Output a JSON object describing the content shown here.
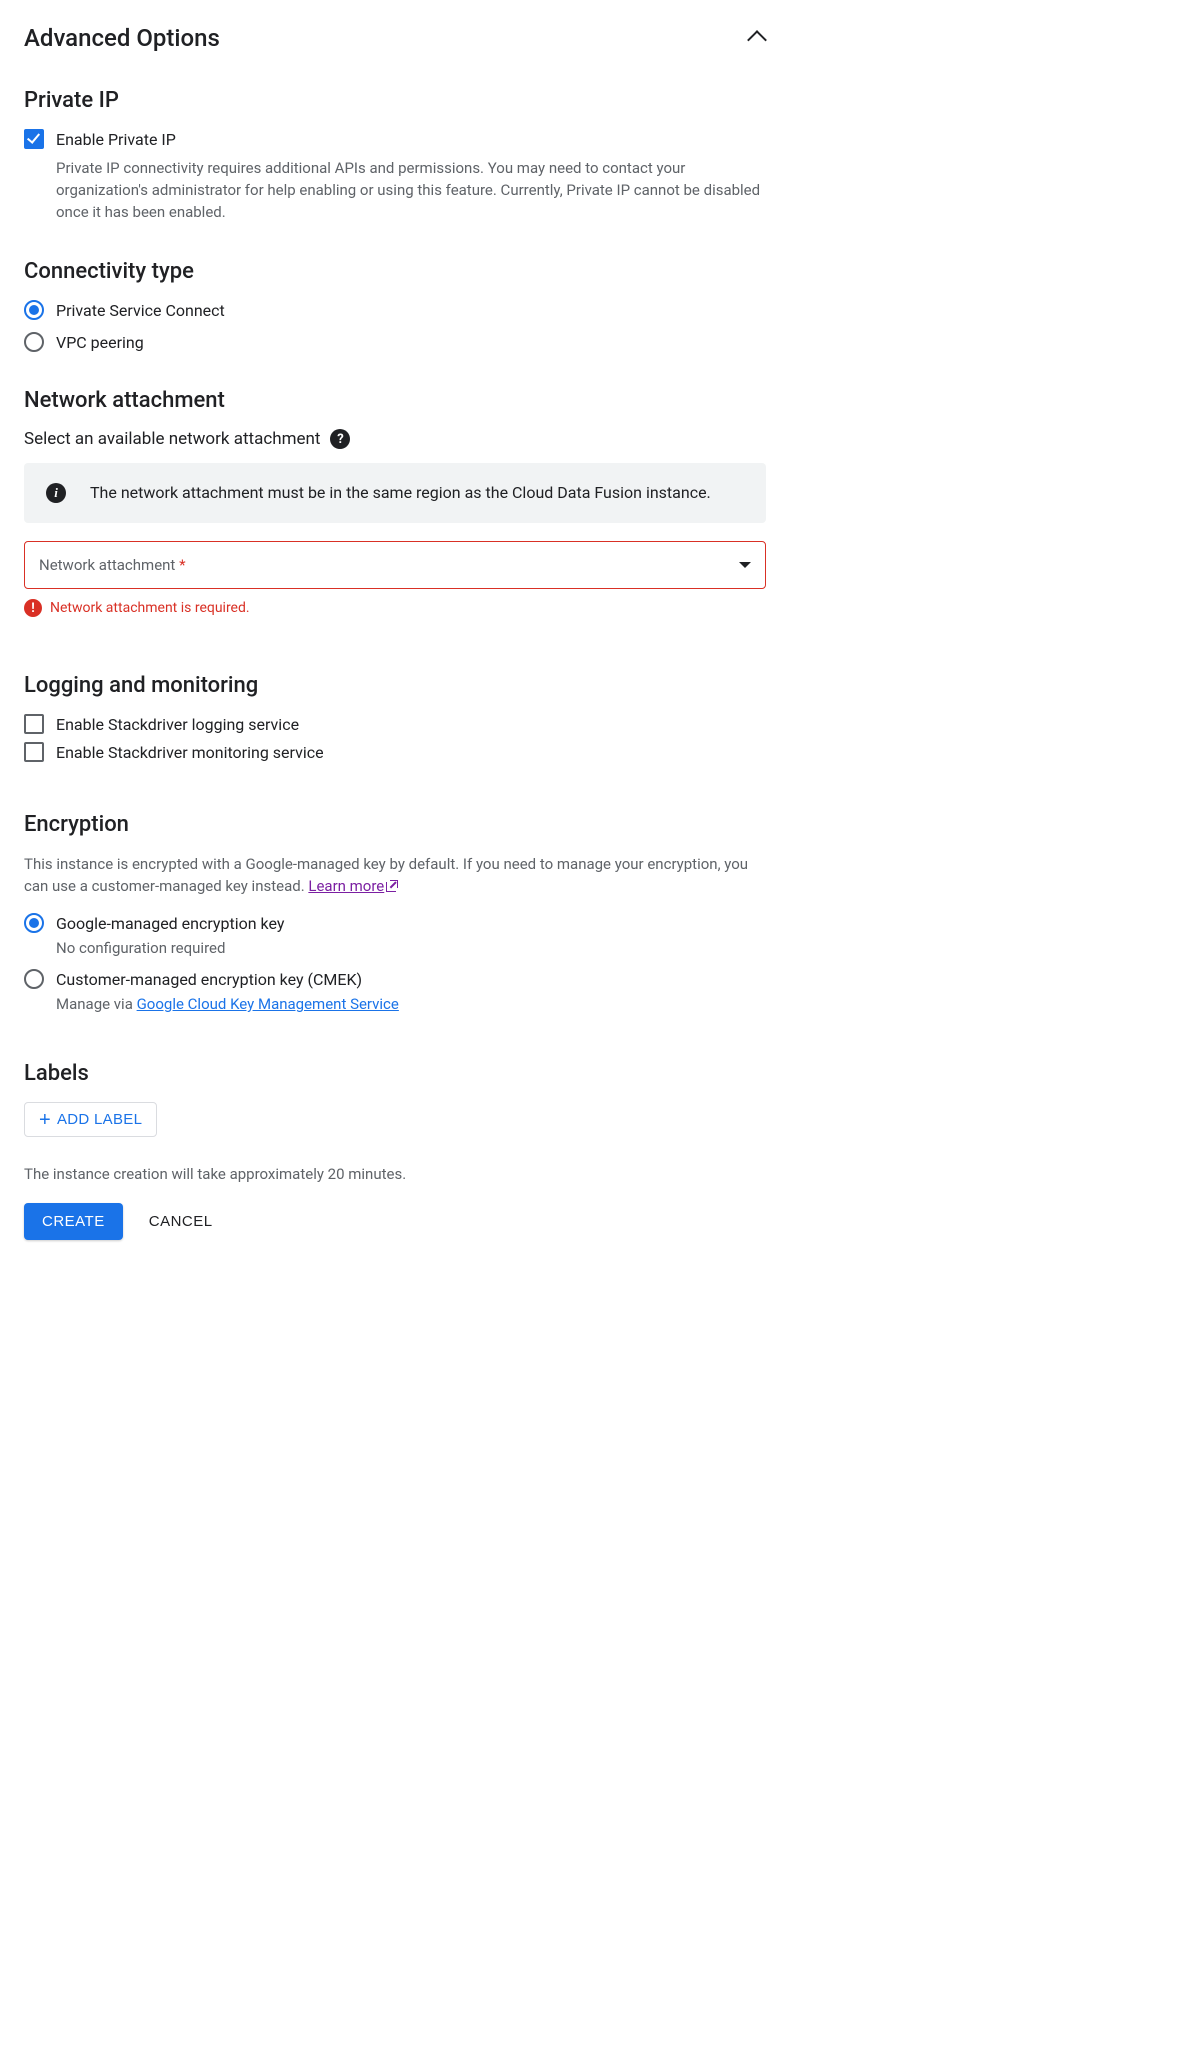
{
  "header": {
    "title": "Advanced Options"
  },
  "private_ip": {
    "heading": "Private IP",
    "enable_label": "Enable Private IP",
    "enable_checked": true,
    "help": "Private IP connectivity requires additional APIs and permissions. You may need to contact your organization's administrator for help enabling or using this feature. Currently, Private IP cannot be disabled once it has been enabled."
  },
  "connectivity": {
    "heading": "Connectivity type",
    "options": [
      {
        "label": "Private Service Connect",
        "selected": true
      },
      {
        "label": "VPC peering",
        "selected": false
      }
    ]
  },
  "network_attachment": {
    "heading": "Network attachment",
    "prompt": "Select an available network attachment",
    "info": "The network attachment must be in the same region as the Cloud Data Fusion instance.",
    "field_label": "Network attachment",
    "required_marker": "*",
    "error": "Network attachment is required."
  },
  "logging": {
    "heading": "Logging and monitoring",
    "options": [
      {
        "label": "Enable Stackdriver logging service",
        "checked": false
      },
      {
        "label": "Enable Stackdriver monitoring service",
        "checked": false
      }
    ]
  },
  "encryption": {
    "heading": "Encryption",
    "desc": "This instance is encrypted with a Google-managed key by default. If you need to manage your encryption, you can use a customer-managed key instead. ",
    "learn_more": "Learn more",
    "options": [
      {
        "label": "Google-managed encryption key",
        "sub": "No configuration required",
        "selected": true
      },
      {
        "label": "Customer-managed encryption key (CMEK)",
        "sub_prefix": "Manage via ",
        "sub_link": "Google Cloud Key Management Service",
        "selected": false
      }
    ]
  },
  "labels": {
    "heading": "Labels",
    "add_button": "ADD LABEL"
  },
  "footer": {
    "note": "The instance creation will take approximately 20 minutes.",
    "create": "CREATE",
    "cancel": "CANCEL"
  }
}
